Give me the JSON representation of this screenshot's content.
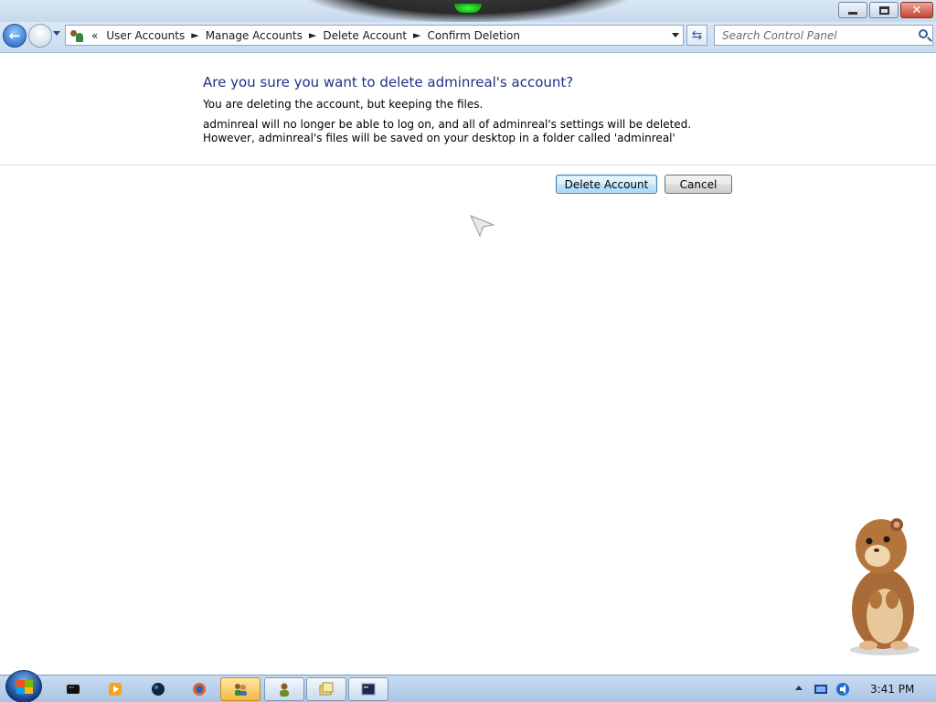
{
  "window": {
    "minimize_label": "Minimize",
    "maximize_label": "Restore",
    "close_label": "Close"
  },
  "nav": {
    "lead_chevron": "«",
    "separator": "►",
    "breadcrumbs": [
      "User Accounts",
      "Manage Accounts",
      "Delete Account",
      "Confirm Deletion"
    ],
    "search_placeholder": "Search Control Panel"
  },
  "main": {
    "heading": "Are you sure you want to delete adminreal's account?",
    "subheading": "You are deleting the account, but keeping the files.",
    "paragraph": "adminreal will no longer be able to log on, and all of adminreal's settings will be deleted. However, adminreal's files will be saved on your desktop in a folder called 'adminreal'",
    "delete_button": "Delete Account",
    "cancel_button": "Cancel"
  },
  "taskbar": {
    "items": [
      "start-orb",
      "terminal-icon",
      "media-player-icon",
      "globe-icon",
      "firefox-icon",
      "user-accounts-icon",
      "user-icon",
      "windows-explorer-icon",
      "command-prompt-icon"
    ],
    "clock": "3:41 PM"
  },
  "colors": {
    "heading": "#1e3287",
    "primary_button": "#a7d9f5",
    "taskbar": "#a9c4e4"
  }
}
